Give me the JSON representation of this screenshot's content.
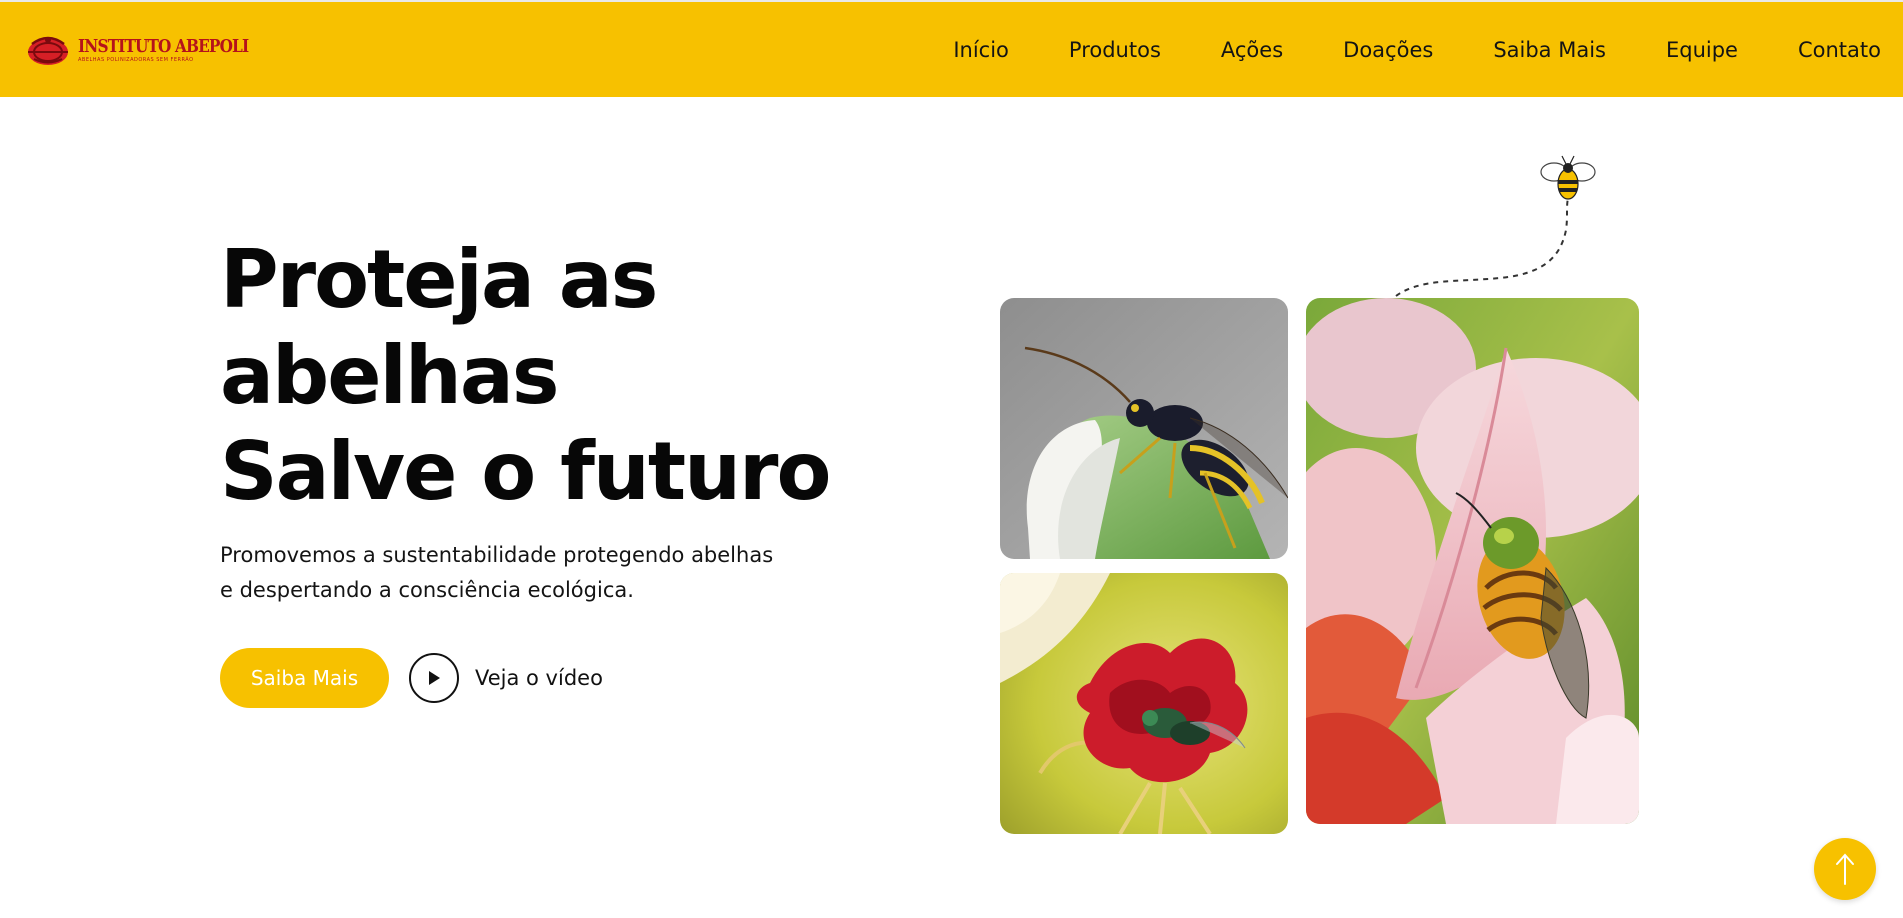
{
  "header": {
    "logo": {
      "title": "INSTITUTO ABEPOLI",
      "subtitle": "ABELHAS POLINIZADORAS SEM FERRÃO",
      "icon": "bee-logo-icon"
    },
    "nav": [
      {
        "label": "Início"
      },
      {
        "label": "Produtos"
      },
      {
        "label": "Ações"
      },
      {
        "label": "Doações"
      },
      {
        "label": "Saiba Mais"
      },
      {
        "label": "Equipe"
      },
      {
        "label": "Contato"
      }
    ]
  },
  "hero": {
    "title_lines": [
      "Proteja as",
      "abelhas",
      "Salve o futuro"
    ],
    "subtitle_lines": [
      "Promovemos a sustentabilidade protegendo abelhas",
      "e despertando a consciência ecológica."
    ],
    "cta_label": "Saiba Mais",
    "video_label": "Veja o vídeo"
  },
  "gallery": {
    "icons": [
      "flying-bee-icon",
      "play-icon",
      "arrow-up-icon"
    ]
  },
  "colors": {
    "brand_yellow": "#f7c100",
    "logo_red": "#b5121b",
    "text": "#0d0d0d"
  }
}
